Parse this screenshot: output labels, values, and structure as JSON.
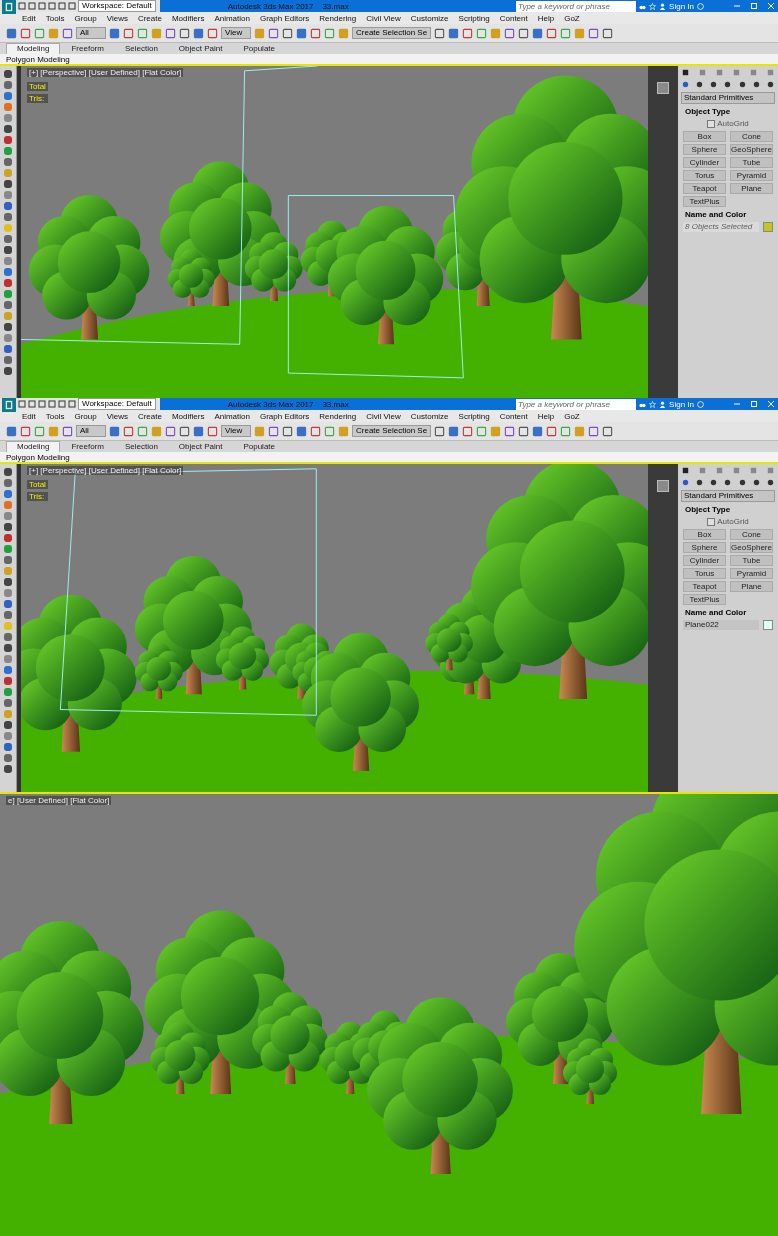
{
  "screens": [
    {
      "kind": "app",
      "title_bar": {
        "workspace": "Workspace: Default",
        "title": "Autodesk 3ds Max 2017    33.max",
        "search": {
          "placeholder": "Type a keyword or phrase"
        },
        "sign_in": "Sign In"
      },
      "menu": [
        "Edit",
        "Tools",
        "Group",
        "Views",
        "Create",
        "Modifiers",
        "Animation",
        "Graph Editors",
        "Rendering",
        "Civil View",
        "Customize",
        "Scripting",
        "Content",
        "Help",
        "GoZ"
      ],
      "toolbar": {
        "selection_filter": "All",
        "reference_coord": "View",
        "named_selection": "Create Selection Se"
      },
      "ribbon_tabs": [
        {
          "label": "Modeling",
          "selected": true
        },
        {
          "label": "Freeform",
          "selected": false
        },
        {
          "label": "Selection",
          "selected": false
        },
        {
          "label": "Object Paint",
          "selected": false
        },
        {
          "label": "Populate",
          "selected": false
        }
      ],
      "ribbon_panel": "Polygon Modeling",
      "viewport": {
        "label": "[+] [Perspective] [User Defined] [Flat Color]",
        "stats": [
          "Total",
          "Tris:"
        ]
      },
      "command_panel": {
        "category": "Standard Primitives",
        "object_type": "Object Type",
        "autogrid": {
          "label": "AutoGrid",
          "checked": false
        },
        "buttons": [
          "Box",
          "Cone",
          "Sphere",
          "GeoSphere",
          "Cylinder",
          "Tube",
          "Torus",
          "Pyramid",
          "Teapot",
          "Plane",
          "TextPlus"
        ],
        "name_and_color": {
          "title": "Name and Color",
          "name": "8 Objects Selected",
          "name_disabled": true,
          "color": "#c8c41e"
        }
      }
    },
    {
      "kind": "app",
      "title_bar": {
        "workspace": "Workspace: Default",
        "title": "Autodesk 3ds Max 2017    33.max",
        "search": {
          "placeholder": "Type a keyword or phrase"
        },
        "sign_in": "Sign In"
      },
      "menu": [
        "Edit",
        "Tools",
        "Group",
        "Views",
        "Create",
        "Modifiers",
        "Animation",
        "Graph Editors",
        "Rendering",
        "Civil View",
        "Customize",
        "Scripting",
        "Content",
        "Help",
        "GoZ"
      ],
      "toolbar": {
        "selection_filter": "All",
        "reference_coord": "View",
        "named_selection": "Create Selection Se"
      },
      "ribbon_tabs": [
        {
          "label": "Modeling",
          "selected": true
        },
        {
          "label": "Freeform",
          "selected": false
        },
        {
          "label": "Selection",
          "selected": false
        },
        {
          "label": "Object Paint",
          "selected": false
        },
        {
          "label": "Populate",
          "selected": false
        }
      ],
      "ribbon_panel": "Polygon Modeling",
      "viewport": {
        "label": "[+] [Perspective] [User Defined] [Flat Color]",
        "stats": [
          "Total",
          "Tris:"
        ]
      },
      "command_panel": {
        "category": "Standard Primitives",
        "object_type": "Object Type",
        "autogrid": {
          "label": "AutoGrid",
          "checked": false
        },
        "buttons": [
          "Box",
          "Cone",
          "Sphere",
          "GeoSphere",
          "Cylinder",
          "Tube",
          "Torus",
          "Pyramid",
          "Teapot",
          "Plane",
          "TextPlus"
        ],
        "name_and_color": {
          "title": "Name and Color",
          "name": "Plane022",
          "name_disabled": false,
          "color": "#e2fbef"
        }
      }
    },
    {
      "kind": "viewport_only",
      "viewport": {
        "label": "e] [User Defined] [Flat Color]"
      }
    }
  ]
}
